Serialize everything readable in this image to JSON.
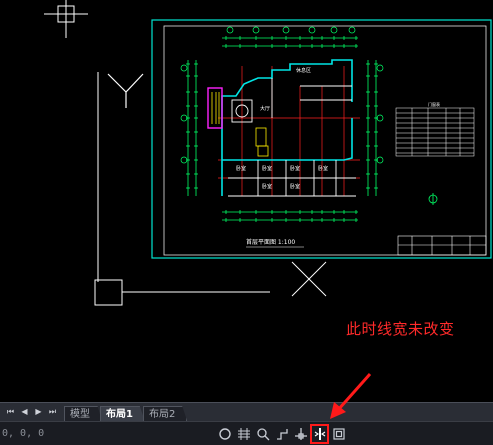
{
  "annotation": {
    "text": "此时线宽未改变",
    "color": "#ff2a2a"
  },
  "layout_tabs": {
    "nav_buttons": [
      {
        "icon": "first-icon",
        "glyph": "⏮"
      },
      {
        "icon": "prev-icon",
        "glyph": "◀"
      },
      {
        "icon": "next-icon",
        "glyph": "▶"
      },
      {
        "icon": "last-icon",
        "glyph": "⏭"
      }
    ],
    "tabs": [
      {
        "label": "模型",
        "active": false
      },
      {
        "label": "布局1",
        "active": true
      },
      {
        "label": "布局2",
        "active": false
      }
    ]
  },
  "status_bar": {
    "coordinates": "0, 0, 0",
    "tools": [
      {
        "icon": "circle-snap-icon",
        "highlight": false
      },
      {
        "icon": "grid-icon",
        "highlight": false
      },
      {
        "icon": "zoom-icon",
        "highlight": false
      },
      {
        "icon": "polar-icon",
        "highlight": false
      },
      {
        "icon": "object-snap-icon",
        "highlight": false
      },
      {
        "icon": "lineweight-icon",
        "highlight": true
      },
      {
        "icon": "viewport-icon",
        "highlight": false
      }
    ]
  },
  "drawing": {
    "title": "首层平面图 1:100",
    "table_heading": "门窗表",
    "accent_color": "#00ff66",
    "viewport_border_color": "#00e5d0",
    "highlight_color": "#ff1a1a"
  }
}
